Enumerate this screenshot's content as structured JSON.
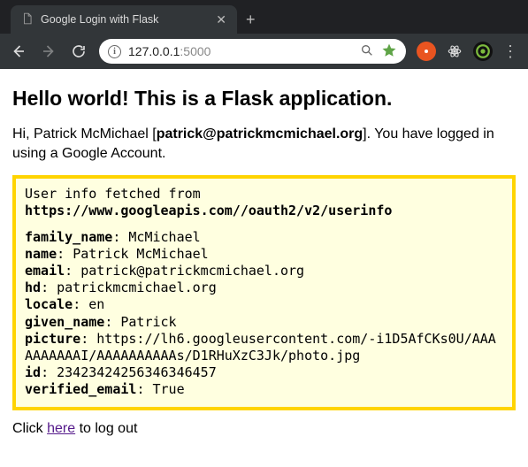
{
  "browser": {
    "tab_title": "Google Login with Flask",
    "url_host": "127.0.0.1",
    "url_port": ":5000",
    "colors": {
      "star": "#5fa447",
      "ext1": "#e95420",
      "ext3_ring": "#7dbb3e"
    }
  },
  "page": {
    "headline": "Hello world! This is a Flask application.",
    "greeting": {
      "prefix": "Hi, ",
      "name": "Patrick McMichael",
      "bracket_open": " [",
      "email": "patrick@patrickmcmichael.org",
      "bracket_close": "].",
      "suffix": " You have logged in using a Google Account."
    },
    "userinfo_caption_prefix": "User info fetched from ",
    "userinfo_url": "https://www.googleapis.com//oauth2/v2/userinfo",
    "userinfo": {
      "family_name": "McMichael",
      "name": "Patrick McMichael",
      "email": "patrick@patrickmcmichael.org",
      "hd": "patrickmcmichael.org",
      "locale": "en",
      "given_name": "Patrick",
      "picture": "https://lh6.googleusercontent.com/-i1D5AfCKs0U/AAAAAAAAAAI/AAAAAAAAAAs/D1RHuXzC3Jk/photo.jpg",
      "id": "23423424256346346457",
      "verified_email": "True"
    },
    "logout_prefix": "Click ",
    "logout_link": "here",
    "logout_suffix": " to log out"
  }
}
